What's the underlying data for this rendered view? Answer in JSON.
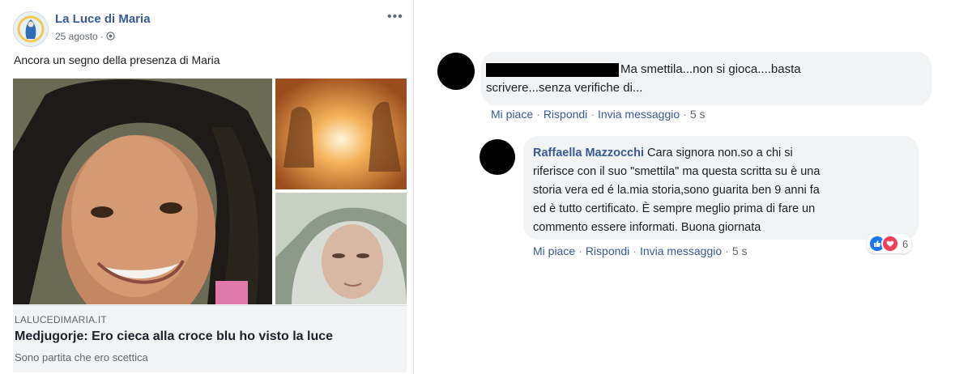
{
  "post": {
    "page_name": "La Luce di Maria",
    "date": "25 agosto",
    "audience_icon": "globe-icon",
    "more_icon": "more-options-icon",
    "text": "Ancora un segno della presenza di Maria",
    "link": {
      "domain": "LALUCEDIMARIA.IT",
      "title": "Medjugorje: Ero cieca alla croce blu ho visto la luce",
      "description": "Sono partita che ero scettica"
    }
  },
  "comments": [
    {
      "author_redacted": true,
      "text_line1": "Ma smettila...non si gioca....basta",
      "text_line2": "scrivere...senza verifiche di...",
      "actions": {
        "like": "Mi piace",
        "reply": "Rispondi",
        "message": "Invia messaggio",
        "time": "5 s"
      }
    }
  ],
  "reply": {
    "author": "Raffaella Mazzocchi",
    "lines": [
      "Cara signora non.so a chi si",
      "riferisce con il suo \"smettila\" ma questa scritta su è una",
      "storia vera ed é la.mia storia,sono guarita ben 9 anni fa",
      "ed è tutto certificato. È sempre meglio prima di fare un",
      "commento essere informati. Buona giornata"
    ],
    "actions": {
      "like": "Mi piace",
      "reply": "Rispondi",
      "message": "Invia messaggio",
      "time": "5 s"
    },
    "reactions": {
      "types": [
        "like",
        "love"
      ],
      "count": "6"
    }
  },
  "colors": {
    "link_blue": "#385898",
    "bubble": "#f2f3f5",
    "like": "#1877f2",
    "love": "#f33e58"
  }
}
